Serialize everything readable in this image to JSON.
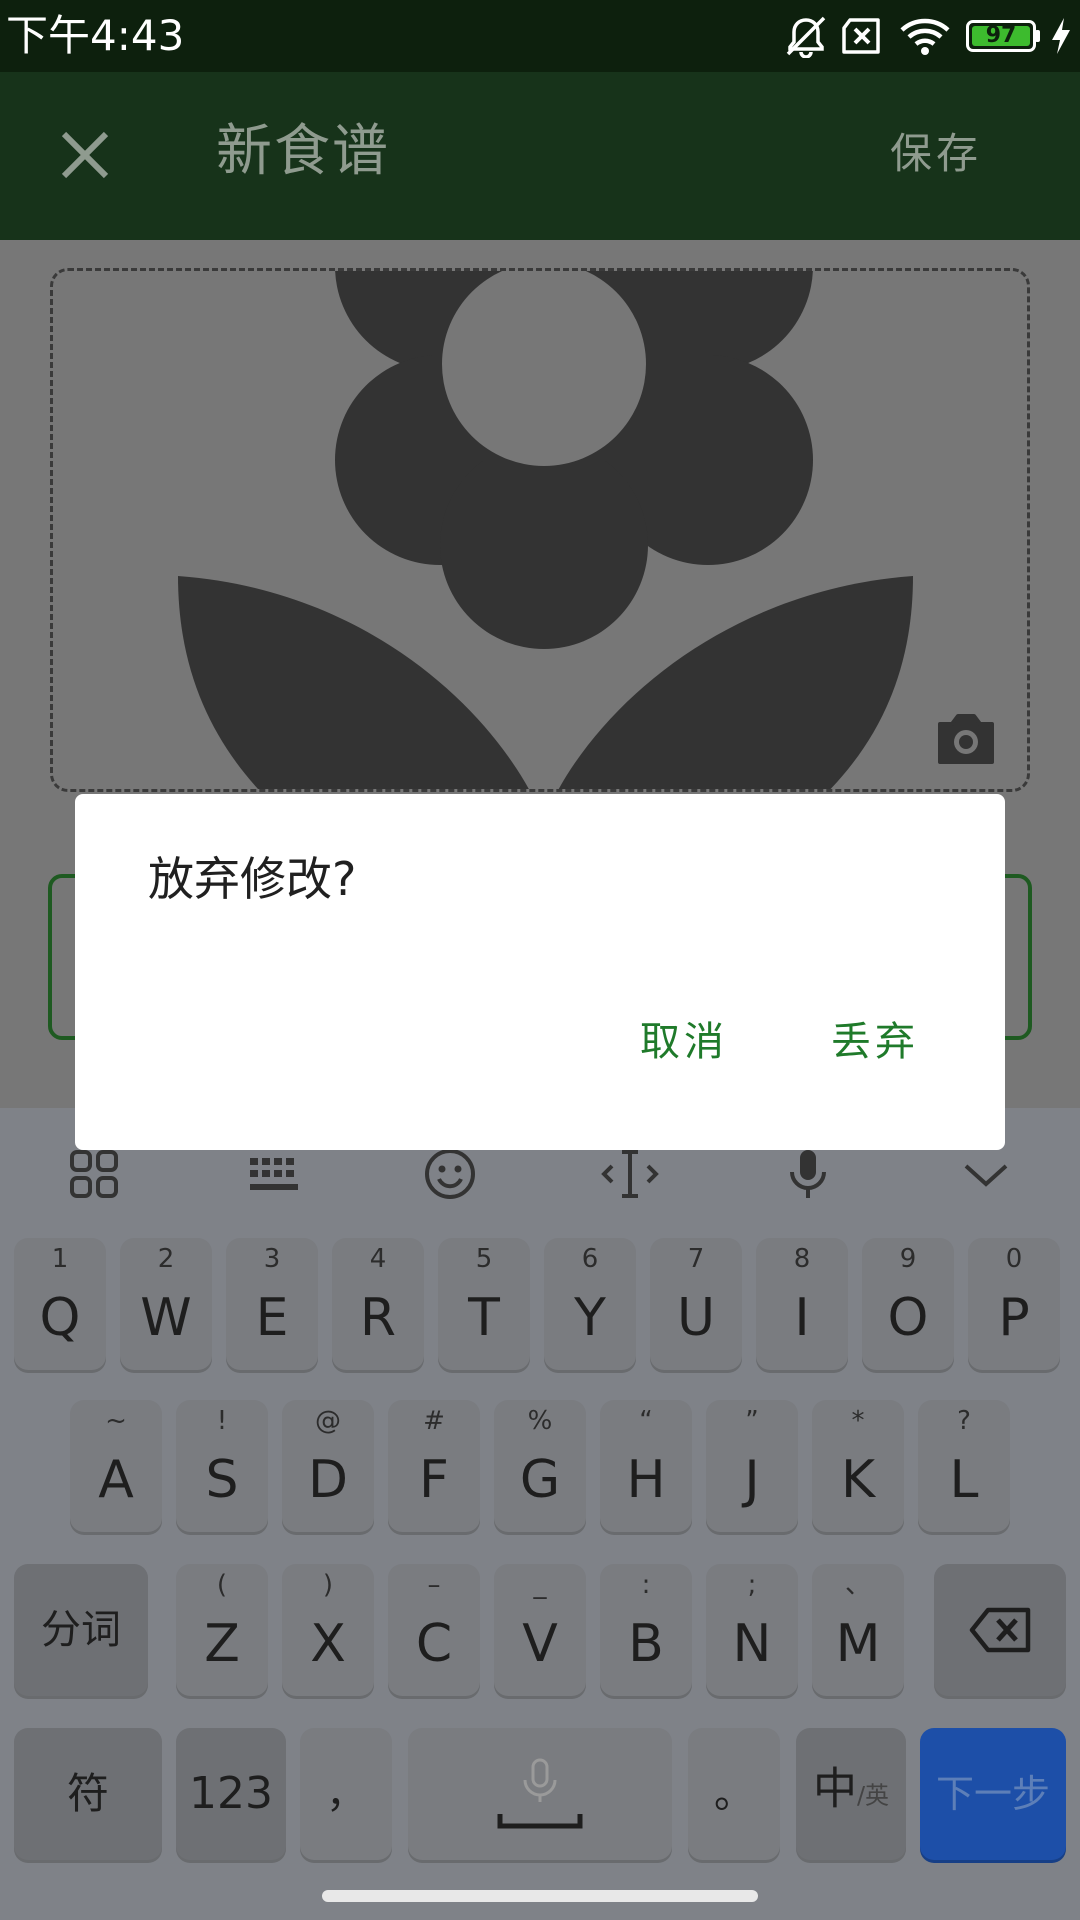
{
  "status_bar": {
    "time": "下午4:43",
    "battery": "97"
  },
  "app_bar": {
    "title": "新食谱",
    "save_label": "保存"
  },
  "dialog": {
    "title": "放弃修改?",
    "cancel_label": "取消",
    "discard_label": "丢弃"
  },
  "keyboard": {
    "row1": [
      {
        "hint": "1",
        "key": "Q"
      },
      {
        "hint": "2",
        "key": "W"
      },
      {
        "hint": "3",
        "key": "E"
      },
      {
        "hint": "4",
        "key": "R"
      },
      {
        "hint": "5",
        "key": "T"
      },
      {
        "hint": "6",
        "key": "Y"
      },
      {
        "hint": "7",
        "key": "U"
      },
      {
        "hint": "8",
        "key": "I"
      },
      {
        "hint": "9",
        "key": "O"
      },
      {
        "hint": "0",
        "key": "P"
      }
    ],
    "row2": [
      {
        "hint": "~",
        "key": "A"
      },
      {
        "hint": "!",
        "key": "S"
      },
      {
        "hint": "@",
        "key": "D"
      },
      {
        "hint": "#",
        "key": "F"
      },
      {
        "hint": "%",
        "key": "G"
      },
      {
        "hint": "“",
        "key": "H"
      },
      {
        "hint": "”",
        "key": "J"
      },
      {
        "hint": "*",
        "key": "K"
      },
      {
        "hint": "?",
        "key": "L"
      }
    ],
    "row3": [
      {
        "hint": "(",
        "key": "Z"
      },
      {
        "hint": ")",
        "key": "X"
      },
      {
        "hint": "–",
        "key": "C"
      },
      {
        "hint": "_",
        "key": "V"
      },
      {
        "hint": ":",
        "key": "B"
      },
      {
        "hint": ";",
        "key": "N"
      },
      {
        "hint": "、",
        "key": "M"
      }
    ],
    "fenci_label": "分词",
    "symbol_label": "符",
    "num_label": "123",
    "comma_label": "，",
    "period_label": "。",
    "lang_main": "中",
    "lang_sub": "/英",
    "next_label": "下一步"
  },
  "colors": {
    "status_bar": "#0d200d",
    "app_bar": "#17331a",
    "accent": "#1f7a2a",
    "next_key": "#1d4fa8"
  }
}
